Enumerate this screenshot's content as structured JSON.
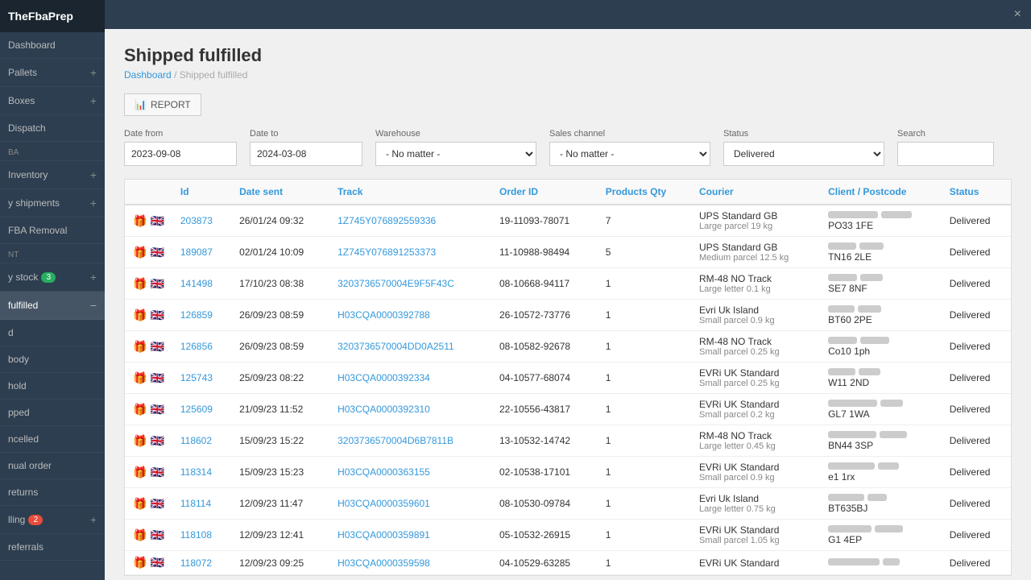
{
  "app": {
    "logo": "TheFbaPrep",
    "topbar_close": "×"
  },
  "sidebar": {
    "items": [
      {
        "id": "dashboard",
        "label": "Dashboard",
        "badge": null,
        "plus": false,
        "active": false
      },
      {
        "id": "pallets",
        "label": "Pallets",
        "badge": null,
        "plus": true,
        "active": false
      },
      {
        "id": "boxes",
        "label": "Boxes",
        "badge": null,
        "plus": true,
        "active": false
      },
      {
        "id": "dispatch",
        "label": "Dispatch",
        "badge": null,
        "plus": false,
        "active": false
      },
      {
        "id": "section-ba",
        "label": "BA",
        "type": "section"
      },
      {
        "id": "inventory",
        "label": "Inventory",
        "badge": null,
        "plus": true,
        "active": false
      },
      {
        "id": "y-shipments",
        "label": "y shipments",
        "badge": null,
        "plus": true,
        "active": false
      },
      {
        "id": "fba-removal",
        "label": "FBA Removal",
        "badge": null,
        "plus": false,
        "active": false
      },
      {
        "id": "section-nt",
        "label": "NT",
        "type": "section"
      },
      {
        "id": "y-stock",
        "label": "y stock",
        "badge": "3",
        "badge_color": "green",
        "plus": true,
        "active": false
      },
      {
        "id": "fulfilled",
        "label": "fulfilled",
        "badge": null,
        "plus": false,
        "active": true
      },
      {
        "id": "d",
        "label": "d",
        "badge": null,
        "plus": false,
        "active": false
      },
      {
        "id": "body",
        "label": "body",
        "badge": null,
        "plus": false,
        "active": false
      },
      {
        "id": "hold",
        "label": "hold",
        "badge": null,
        "plus": false,
        "active": false
      },
      {
        "id": "pped",
        "label": "pped",
        "badge": null,
        "plus": false,
        "active": false
      },
      {
        "id": "ncelled",
        "label": "ncelled",
        "badge": null,
        "plus": false,
        "active": false
      },
      {
        "id": "nual-order",
        "label": "nual order",
        "badge": null,
        "plus": false,
        "active": false
      },
      {
        "id": "returns",
        "label": "returns",
        "badge": null,
        "plus": false,
        "active": false
      },
      {
        "id": "lling",
        "label": "lling",
        "badge": "2",
        "badge_color": "red",
        "plus": true,
        "active": false
      },
      {
        "id": "referrals",
        "label": "referrals",
        "badge": null,
        "plus": false,
        "active": false
      }
    ]
  },
  "page": {
    "title": "Shipped fulfilled",
    "breadcrumb_home": "Dashboard",
    "breadcrumb_current": "Shipped fulfilled"
  },
  "toolbar": {
    "report_label": "REPORT"
  },
  "filters": {
    "date_from_label": "Date from",
    "date_from_value": "2023-09-08",
    "date_to_label": "Date to",
    "date_to_value": "2024-03-08",
    "warehouse_label": "Warehouse",
    "warehouse_value": "- No matter -",
    "sales_channel_label": "Sales channel",
    "sales_channel_value": "- No matter -",
    "status_label": "Status",
    "status_value": "Delivered",
    "search_label": "Search"
  },
  "table": {
    "columns": [
      "Id",
      "Date sent",
      "Track",
      "Order ID",
      "Products Qty",
      "Courier",
      "Client / Postcode",
      "Status"
    ],
    "rows": [
      {
        "id": "203873",
        "date_sent": "26/01/24 09:32",
        "track": "1Z745Y076892559336",
        "order_id": "19-11093-78071",
        "products_qty": "7",
        "courier_main": "UPS Standard GB",
        "courier_sub": "Large parcel 19 kg",
        "postcode": "PO33 1FE",
        "status": "Delivered"
      },
      {
        "id": "189087",
        "date_sent": "02/01/24 10:09",
        "track": "1Z745Y076891253373",
        "order_id": "11-10988-98494",
        "products_qty": "5",
        "courier_main": "UPS Standard GB",
        "courier_sub": "Medium parcel 12.5 kg",
        "postcode": "TN16 2LE",
        "status": "Delivered"
      },
      {
        "id": "141498",
        "date_sent": "17/10/23 08:38",
        "track": "3203736570004E9F5F43C",
        "order_id": "08-10668-94117",
        "products_qty": "1",
        "courier_main": "RM-48 NO Track",
        "courier_sub": "Large letter 0.1 kg",
        "postcode": "SE7 8NF",
        "status": "Delivered"
      },
      {
        "id": "126859",
        "date_sent": "26/09/23 08:59",
        "track": "H03CQA0000392788",
        "order_id": "26-10572-73776",
        "products_qty": "1",
        "courier_main": "Evri Uk Island",
        "courier_sub": "Small parcel 0.9 kg",
        "postcode": "BT60 2PE",
        "status": "Delivered"
      },
      {
        "id": "126856",
        "date_sent": "26/09/23 08:59",
        "track": "3203736570004DD0A2511",
        "order_id": "08-10582-92678",
        "products_qty": "1",
        "courier_main": "RM-48 NO Track",
        "courier_sub": "Small parcel 0.25 kg",
        "postcode": "Co10 1ph",
        "status": "Delivered"
      },
      {
        "id": "125743",
        "date_sent": "25/09/23 08:22",
        "track": "H03CQA0000392334",
        "order_id": "04-10577-68074",
        "products_qty": "1",
        "courier_main": "EVRi UK Standard",
        "courier_sub": "Small parcel 0.25 kg",
        "postcode": "W11 2ND",
        "status": "Delivered"
      },
      {
        "id": "125609",
        "date_sent": "21/09/23 11:52",
        "track": "H03CQA0000392310",
        "order_id": "22-10556-43817",
        "products_qty": "1",
        "courier_main": "EVRi UK Standard",
        "courier_sub": "Small parcel 0.2 kg",
        "postcode": "GL7 1WA",
        "status": "Delivered"
      },
      {
        "id": "118602",
        "date_sent": "15/09/23 15:22",
        "track": "3203736570004D6B7811B",
        "order_id": "13-10532-14742",
        "products_qty": "1",
        "courier_main": "RM-48 NO Track",
        "courier_sub": "Large letter 0.45 kg",
        "postcode": "BN44 3SP",
        "status": "Delivered"
      },
      {
        "id": "118314",
        "date_sent": "15/09/23 15:23",
        "track": "H03CQA0000363155",
        "order_id": "02-10538-17101",
        "products_qty": "1",
        "courier_main": "EVRi UK Standard",
        "courier_sub": "Small parcel 0.9 kg",
        "postcode": "e1 1rx",
        "status": "Delivered"
      },
      {
        "id": "118114",
        "date_sent": "12/09/23 11:47",
        "track": "H03CQA0000359601",
        "order_id": "08-10530-09784",
        "products_qty": "1",
        "courier_main": "Evri Uk Island",
        "courier_sub": "Large letter 0.75 kg",
        "postcode": "BT635BJ",
        "status": "Delivered"
      },
      {
        "id": "118108",
        "date_sent": "12/09/23 12:41",
        "track": "H03CQA0000359891",
        "order_id": "05-10532-26915",
        "products_qty": "1",
        "courier_main": "EVRi UK Standard",
        "courier_sub": "Small parcel 1.05 kg",
        "postcode": "G1 4EP",
        "status": "Delivered"
      },
      {
        "id": "118072",
        "date_sent": "12/09/23 09:25",
        "track": "H03CQA0000359598",
        "order_id": "04-10529-63285",
        "products_qty": "1",
        "courier_main": "EVRi UK Standard",
        "courier_sub": "",
        "postcode": "",
        "status": "Delivered"
      }
    ]
  }
}
